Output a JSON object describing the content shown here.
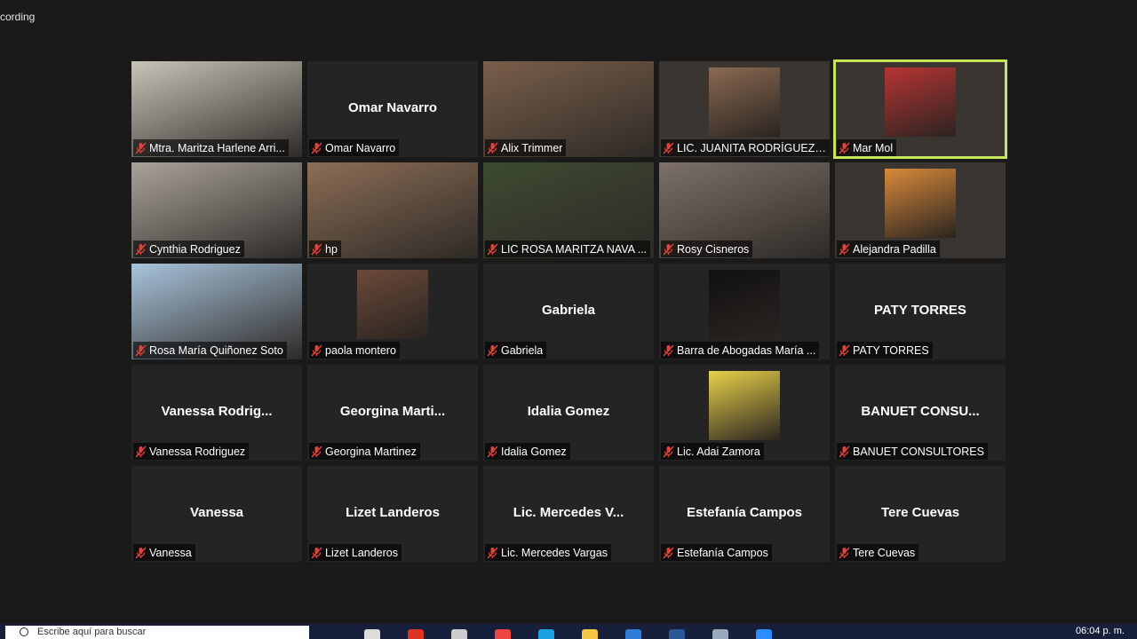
{
  "window": {
    "recording_label": "cording"
  },
  "colors": {
    "active_speaker_outline": "#c8e65a",
    "muted_mic": "#e0413a",
    "tile_bg": "#242424"
  },
  "participants": [
    {
      "name": "Mtra. Maritza Harlene Arri...",
      "video": true,
      "active": false,
      "bg": "#c9c4b8"
    },
    {
      "name": "Omar Navarro",
      "center": "Omar Navarro",
      "video": false
    },
    {
      "name": "Alix Trimmer",
      "video": true,
      "bg": "#7a5f4a"
    },
    {
      "name": "LIC. JUANITA RODRÍGUEZ Z...",
      "video": true,
      "avatar": true,
      "bg": "#8a6a52"
    },
    {
      "name": "Mar Mol",
      "video": true,
      "active": true,
      "avatar": true,
      "bg": "#b73434"
    },
    {
      "name": "Cynthia Rodriguez",
      "video": true,
      "bg": "#a9a39a"
    },
    {
      "name": "hp",
      "video": true,
      "bg": "#8c6e55"
    },
    {
      "name": "LIC ROSA MARITZA NAVA ...",
      "video": true,
      "bg": "#3d4a30"
    },
    {
      "name": "Rosy Cisneros",
      "video": true,
      "bg": "#7d7168"
    },
    {
      "name": "Alejandra Padilla",
      "video": true,
      "avatar": true,
      "bg": "#d98a3a"
    },
    {
      "name": "Rosa María Quiñonez Soto",
      "video": true,
      "bg": "#a8c4dc"
    },
    {
      "name": "paola montero",
      "video": false,
      "avatar": true,
      "bg": "#6b4a3a"
    },
    {
      "name": "Gabriela",
      "center": "Gabriela",
      "video": false
    },
    {
      "name": "Barra de Abogadas María ...",
      "video": false,
      "avatar": true,
      "bg": "#111111"
    },
    {
      "name": "PATY TORRES",
      "center": "PATY TORRES",
      "video": false
    },
    {
      "name": "Vanessa Rodriguez",
      "center": "Vanessa  Rodrig...",
      "video": false
    },
    {
      "name": "Georgina Martinez",
      "center": "Georgina  Marti...",
      "video": false
    },
    {
      "name": "Idalia Gomez",
      "center": "Idalia Gomez",
      "video": false
    },
    {
      "name": "Lic. Adai Zamora",
      "video": false,
      "avatar": true,
      "bg": "#e8d24a"
    },
    {
      "name": "BANUET CONSULTORES",
      "center": "BANUET  CONSU...",
      "video": false
    },
    {
      "name": "Vanessa",
      "center": "Vanessa",
      "video": false
    },
    {
      "name": "Lizet Landeros",
      "center": "Lizet Landeros",
      "video": false
    },
    {
      "name": "Lic. Mercedes Vargas",
      "center": "Lic.  Mercedes  V...",
      "video": false
    },
    {
      "name": "Estefanía Campos",
      "center": "Estefanía Campos",
      "video": false
    },
    {
      "name": "Tere Cuevas",
      "center": "Tere Cuevas",
      "video": false
    }
  ],
  "taskbar": {
    "search_placeholder": "Escribe aquí para buscar",
    "clock": "06:04 p. m.",
    "icons": [
      "search-icon",
      "task-view-icon",
      "app-red-icon",
      "store-icon",
      "chrome-icon",
      "edge-icon",
      "file-explorer-icon",
      "mail-icon",
      "word-icon",
      "app-icon",
      "zoom-icon"
    ]
  }
}
